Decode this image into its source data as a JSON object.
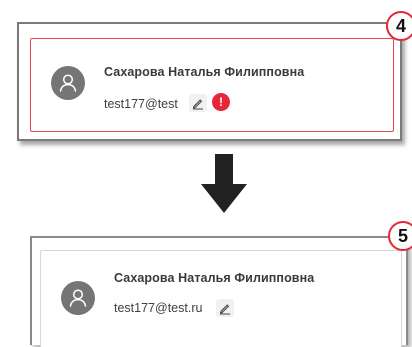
{
  "step_top": {
    "badge": "4",
    "user_name": "Сахарова Наталья Филипповна",
    "email": "test177@test",
    "has_error": true,
    "error_symbol": "!"
  },
  "step_bottom": {
    "badge": "5",
    "user_name": "Сахарова Наталья Филипповна",
    "email": "test177@test.ru",
    "has_error": false
  },
  "icons": {
    "avatar": "user-icon",
    "edit": "pencil-icon",
    "error": "error-icon",
    "transition": "arrow-down-icon"
  },
  "colors": {
    "error_red": "#e8263a",
    "avatar_gray": "#757575",
    "arrow": "#222222"
  }
}
